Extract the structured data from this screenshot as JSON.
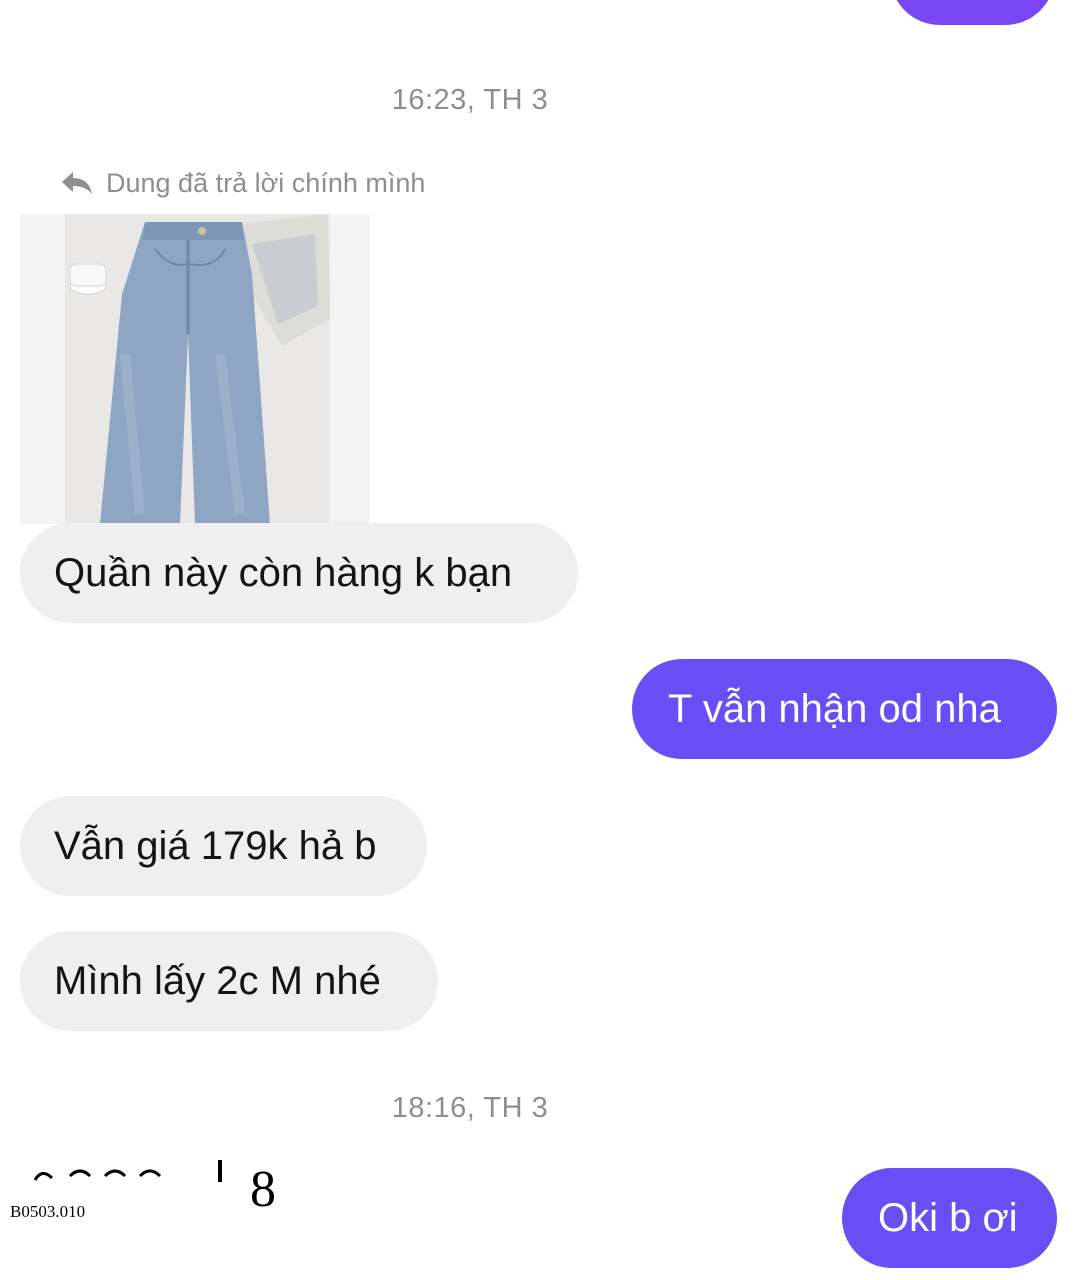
{
  "chat": {
    "timestamps": [
      "16:23, TH 3",
      "18:16, TH 3"
    ],
    "reply_note": "Dung đã trả lời chính mình",
    "messages": [
      {
        "side": "in",
        "text": "Quần này còn hàng k bạn"
      },
      {
        "side": "out",
        "text": "T vẫn nhận od nha"
      },
      {
        "side": "in",
        "text": "Vẫn giá 179k hả b"
      },
      {
        "side": "in",
        "text": "Mình lấy 2c M nhé"
      },
      {
        "side": "out",
        "text": "Oki b ơi"
      }
    ],
    "attachment": {
      "kind": "photo",
      "subject": "light-blue wide-leg jeans"
    }
  },
  "overlay": {
    "partial_text": "8",
    "code_label": "B0503.010"
  },
  "colors": {
    "outgoing_bubble": "#6a4ef5",
    "incoming_bubble": "#efefef",
    "meta_text": "#8e8e8e"
  }
}
